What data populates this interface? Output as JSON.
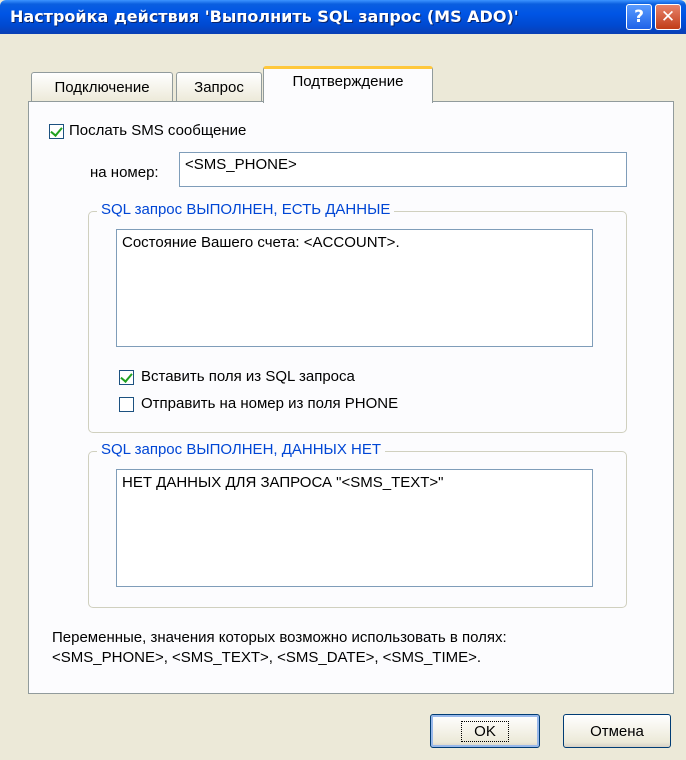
{
  "window": {
    "title": "Настройка действия 'Выполнить SQL запрос (MS ADO)'",
    "help_glyph": "?",
    "close_glyph": "✕"
  },
  "tabs": [
    {
      "label": "Подключение",
      "active": false
    },
    {
      "label": "Запрос",
      "active": false
    },
    {
      "label": "Подтверждение",
      "active": true
    }
  ],
  "sms": {
    "send_label": "Послать SMS сообщение",
    "send_checked": true,
    "number_label": "на номер:",
    "number_value": "<SMS_PHONE>"
  },
  "group_has_data": {
    "caption": "SQL запрос ВЫПОЛНЕН, ЕСТЬ ДАННЫЕ",
    "text": "Состояние Вашего счета: <ACCOUNT>.",
    "insert_fields_label": "Вставить поля из SQL запроса",
    "insert_fields_checked": true,
    "send_to_phone_field_label": "Отправить на номер из поля PHONE",
    "send_to_phone_field_checked": false
  },
  "group_no_data": {
    "caption": "SQL запрос ВЫПОЛНЕН, ДАННЫХ НЕТ",
    "text": "НЕТ ДАННЫХ ДЛЯ ЗАПРОСА \"<SMS_TEXT>\""
  },
  "footer": {
    "line1": "Переменные, значения которых возможно использовать в полях:",
    "line2": "<SMS_PHONE>, <SMS_TEXT>, <SMS_DATE>, <SMS_TIME>."
  },
  "buttons": {
    "ok": "OK",
    "cancel": "Отмена"
  },
  "colors": {
    "titlebar": "#0055e5",
    "window_bg": "#ece9d8",
    "panel_bg": "#fcfcfe",
    "group_caption": "#0046d5",
    "active_tab_accent": "#ffc83c"
  }
}
